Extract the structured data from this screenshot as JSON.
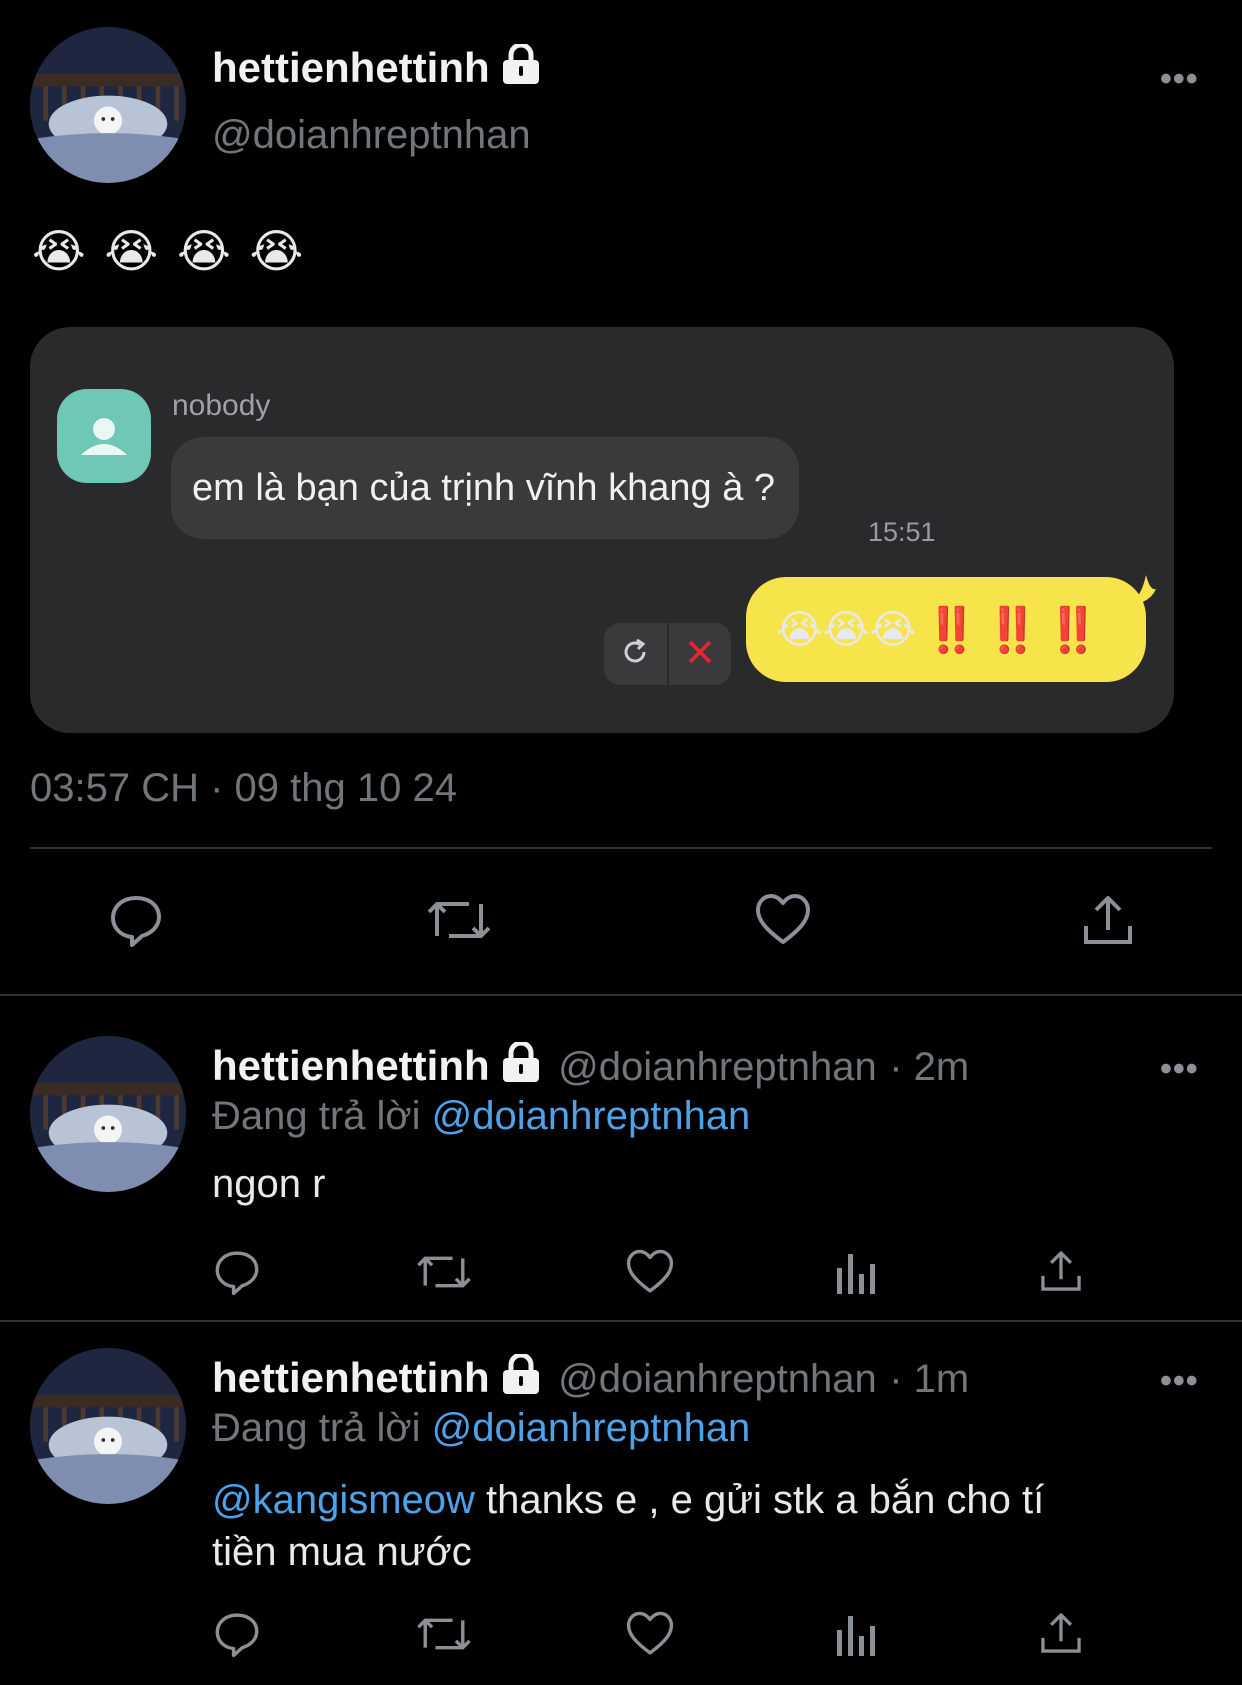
{
  "main_tweet": {
    "display_name": "hettienhettinh",
    "handle": "@doianhreptnhan",
    "more_label": "•••",
    "emojis": [
      "😭",
      "😭",
      "😭",
      "😭"
    ],
    "timestamp": "03:57 CH · 09 thg 10 24"
  },
  "chat": {
    "sender": "nobody",
    "incoming_message": "em là bạn của trịnh vĩnh khang à ?",
    "incoming_time": "15:51",
    "outgoing_emojis": "😭😭😭",
    "outgoing_marks": [
      "‼️",
      "‼️",
      "‼️"
    ],
    "outgoing_bubble_color": "#f7e44a",
    "error_color": "#e8262f"
  },
  "replies": [
    {
      "display_name": "hettienhettinh",
      "handle": "@doianhreptnhan",
      "time": "· 2m",
      "replying_label": "Đang trả lời",
      "replying_to": "@doianhreptnhan",
      "text": "ngon r",
      "more_label": "•••"
    },
    {
      "display_name": "hettienhettinh",
      "handle": "@doianhreptnhan",
      "time": "· 1m",
      "replying_label": "Đang trả lời",
      "replying_to": "@doianhreptnhan",
      "mention": "@kangismeow",
      "text_line1": " thanks e , e gửi stk a bắn cho tí",
      "text_line2": "tiền mua nước",
      "more_label": "•••"
    }
  ],
  "icons": {
    "reply": "reply-bubble-icon",
    "retweet": "retweet-icon",
    "like": "heart-icon",
    "views": "bar-chart-icon",
    "share": "share-icon",
    "lock": "lock-icon",
    "retry": "refresh-icon",
    "cancel": "close-icon"
  },
  "colors": {
    "link": "#4ea2e8",
    "secondary_text": "#71767b",
    "icon": "#8b9096"
  }
}
